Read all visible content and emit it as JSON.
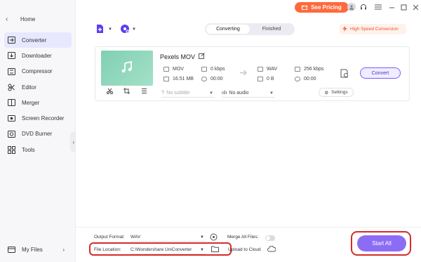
{
  "sidebar": {
    "home_label": "Home",
    "items": [
      {
        "label": "Converter",
        "icon": "converter-icon",
        "active": true
      },
      {
        "label": "Downloader",
        "icon": "downloader-icon"
      },
      {
        "label": "Compressor",
        "icon": "compressor-icon"
      },
      {
        "label": "Editor",
        "icon": "editor-icon"
      },
      {
        "label": "Merger",
        "icon": "merger-icon"
      },
      {
        "label": "Screen Recorder",
        "icon": "screen-recorder-icon"
      },
      {
        "label": "DVD Burner",
        "icon": "dvd-burner-icon"
      },
      {
        "label": "Tools",
        "icon": "tools-icon"
      }
    ],
    "my_files_label": "My Files"
  },
  "titlebar": {
    "pricing_label": "See Pricing"
  },
  "toolbar": {
    "tabs": [
      {
        "label": "Converting",
        "active": true
      },
      {
        "label": "Finished"
      }
    ],
    "high_speed_label": "High Speed Conversion"
  },
  "file": {
    "name": "Pexels MOV",
    "source": {
      "format": "MOV",
      "bitrate": "0 kbps",
      "size": "16.51 MB",
      "duration": "00:00"
    },
    "target": {
      "format": "WAV",
      "bitrate": "256 kbps",
      "size": "0 B",
      "duration": "00:00"
    },
    "convert_label": "Convert",
    "subtitle_value": "No subtitle",
    "audio_value": "No audio",
    "settings_label": "Settings"
  },
  "bottom": {
    "output_format_label": "Output Format:",
    "output_format_value": "WAV",
    "merge_label": "Merge All Files:",
    "file_location_label": "File Location:",
    "file_location_value": "C:\\Wondershare UniConverter",
    "upload_label": "Upload to Cloud",
    "start_all_label": "Start All"
  },
  "colors": {
    "accent": "#8d6cf5",
    "pricing": "#ff6a3c",
    "highlight_box": "#d62b2b",
    "active_nav": "#e7e8ff"
  }
}
